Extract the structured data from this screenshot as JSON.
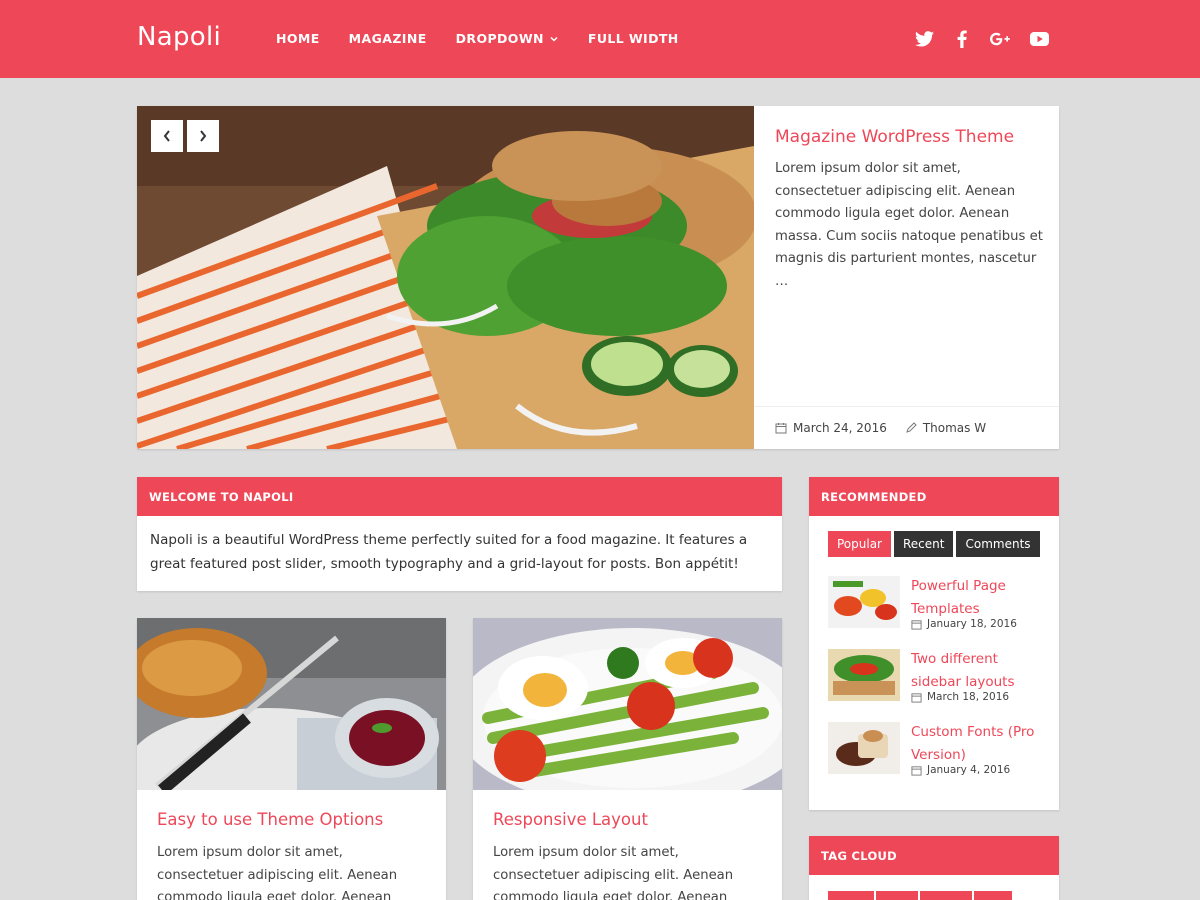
{
  "site": {
    "title": "Napoli"
  },
  "nav": {
    "items": [
      {
        "label": "HOME"
      },
      {
        "label": "MAGAZINE"
      },
      {
        "label": "DROPDOWN",
        "icon": "chevron-down-icon"
      },
      {
        "label": "FULL WIDTH"
      }
    ]
  },
  "social": {
    "icons": [
      "twitter-icon",
      "facebook-icon",
      "google-plus-icon",
      "youtube-icon"
    ]
  },
  "slider": {
    "title": "Magazine WordPress Theme",
    "excerpt": "Lorem ipsum dolor sit amet, consectetuer adipiscing elit. Aenean commodo ligula eget dolor. Aenean massa. Cum sociis natoque penatibus et magnis dis parturient montes, nascetur …",
    "date": "March 24, 2016",
    "author": "Thomas W"
  },
  "welcome": {
    "heading": "WELCOME TO NAPOLI",
    "text": "Napoli is a beautiful WordPress theme perfectly suited for a food magazine. It features a great featured post slider, smooth typography and a grid-layout for posts. Bon appétit!"
  },
  "posts": [
    {
      "title": "Easy to use Theme Options",
      "excerpt": "Lorem ipsum dolor sit amet, consectetuer adipiscing elit. Aenean commodo ligula eget dolor. Aenean massa. Cum sociis natoque"
    },
    {
      "title": "Responsive Layout",
      "excerpt": "Lorem ipsum dolor sit amet, consectetuer adipiscing elit. Aenean commodo ligula eget dolor. Aenean massa. Cum sociis natoque"
    }
  ],
  "recommended": {
    "heading": "RECOMMENDED",
    "tabs": [
      "Popular",
      "Recent",
      "Comments"
    ],
    "active_tab": "Popular",
    "items": [
      {
        "title": "Powerful Page Templates",
        "date": "January 18, 2016"
      },
      {
        "title": "Two different sidebar layouts",
        "date": "March 18, 2016"
      },
      {
        "title": "Custom Fonts (Pro Version)",
        "date": "January 4, 2016"
      }
    ]
  },
  "tagcloud": {
    "heading": "TAG CLOUD"
  },
  "colors": {
    "accent": "#ee4758",
    "background": "#dddddd",
    "dark_tab": "#333333"
  }
}
